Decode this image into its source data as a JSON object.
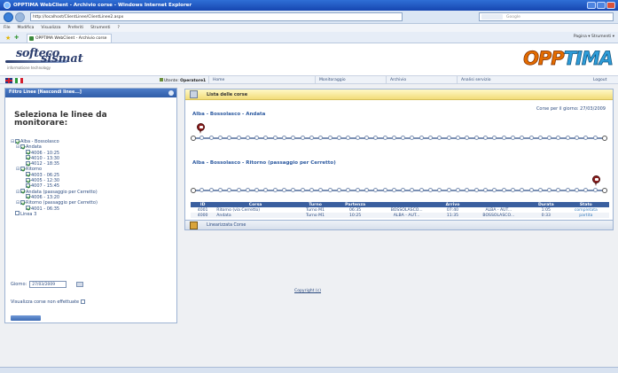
{
  "browser": {
    "window_title": "OPPTIMA WebClient - Archivio corse - Windows Internet Explorer",
    "address": "http://localhost/ClientLinee/ClientLinee2.aspx",
    "search_placeholder": "Google",
    "menu": [
      "File",
      "Modifica",
      "Visualizza",
      "Preferiti",
      "Strumenti",
      "?"
    ],
    "tab_label": "OPPTIMA WebClient - Archivio corse",
    "tools": "Pagina ▾  Strumenti ▾"
  },
  "header": {
    "logo_soft_1": "softeco",
    "logo_soft_2": "sismat",
    "logo_soft_3": "informatione technology",
    "logo_opp_1": "OPP",
    "logo_opp_2": "TIMA"
  },
  "navbar": {
    "user_label": "Utente:",
    "user_name": "Operatore1",
    "items": [
      "Home",
      "Monitoraggio",
      "Archivio",
      "Analisi servizio",
      "Logout"
    ]
  },
  "left_panel": {
    "header": "Filtro Linee   [Nascondi linee...]",
    "title": "Seleziona le linee da monitorare:",
    "tree": [
      {
        "level": 0,
        "expander": "⊟",
        "checked": true,
        "label": "Alba - Bossolasco"
      },
      {
        "level": 1,
        "expander": "⊟",
        "checked": true,
        "label": "Andata"
      },
      {
        "level": 2,
        "expander": "",
        "checked": true,
        "label": "4006 - 10:25"
      },
      {
        "level": 2,
        "expander": "",
        "checked": true,
        "label": "4010 - 13:30"
      },
      {
        "level": 2,
        "expander": "",
        "checked": true,
        "label": "4012 - 18:35"
      },
      {
        "level": 1,
        "expander": "⊟",
        "checked": true,
        "label": "Ritorno"
      },
      {
        "level": 2,
        "expander": "",
        "checked": true,
        "label": "4003 - 06:25"
      },
      {
        "level": 2,
        "expander": "",
        "checked": true,
        "label": "4005 - 12:30"
      },
      {
        "level": 2,
        "expander": "",
        "checked": true,
        "label": "4007 - 15:45"
      },
      {
        "level": 1,
        "expander": "⊟",
        "checked": true,
        "label": "Andata (passaggio per Cerretto)"
      },
      {
        "level": 2,
        "expander": "",
        "checked": true,
        "label": "4006 - 13:20"
      },
      {
        "level": 1,
        "expander": "⊟",
        "checked": true,
        "label": "Ritorno (passaggio per Cerretto)"
      },
      {
        "level": 2,
        "expander": "",
        "checked": true,
        "label": "4001 - 06:35"
      },
      {
        "level": 0,
        "expander": "",
        "checked": false,
        "label": "Linea 3"
      }
    ],
    "date_label": "Giorno:",
    "date_value": "27/03/2009",
    "non_run_label": "Visualizza corse non effettuate"
  },
  "right_panel": {
    "header": "Lista delle corse",
    "date_text": "Corse per il giorno: 27/03/2009",
    "route1_title": "Alba - Bossolasco - Andata",
    "route2_title": "Alba - Bossolasco - Ritorno (passaggio per Cerretto)",
    "stops_per_track": 46,
    "route1_bus_position": 0.02,
    "route2_bus_position": 0.98,
    "table": {
      "headers": [
        "ID",
        "Corsa",
        "Turno",
        "Partenza",
        "",
        "Arrivo",
        "",
        "Durata",
        "Stato"
      ],
      "rows": [
        [
          "4001",
          "Ritorno (via Cerretto)",
          "Turno M1",
          "06:35",
          "BOSSOLASCO...",
          "07:40",
          "ALBA - AUT...",
          "1:05",
          "completata"
        ],
        [
          "4000",
          "Andata",
          "Turno M1",
          "10:25",
          "ALBA - AUT...",
          "11:35",
          "BOSSOLASCO...",
          "0:33",
          "partita"
        ]
      ]
    }
  },
  "linearizzata": "Linearizzata Corse",
  "footer": {
    "copyright": "Copyright (c)"
  },
  "colors": {
    "accent_blue": "#2f5da8",
    "bus_marker": "#8b1d1d",
    "header_yellow": "#f2dc78",
    "logo_orange": "#e36c00",
    "logo_blue": "#2e9cd8"
  }
}
